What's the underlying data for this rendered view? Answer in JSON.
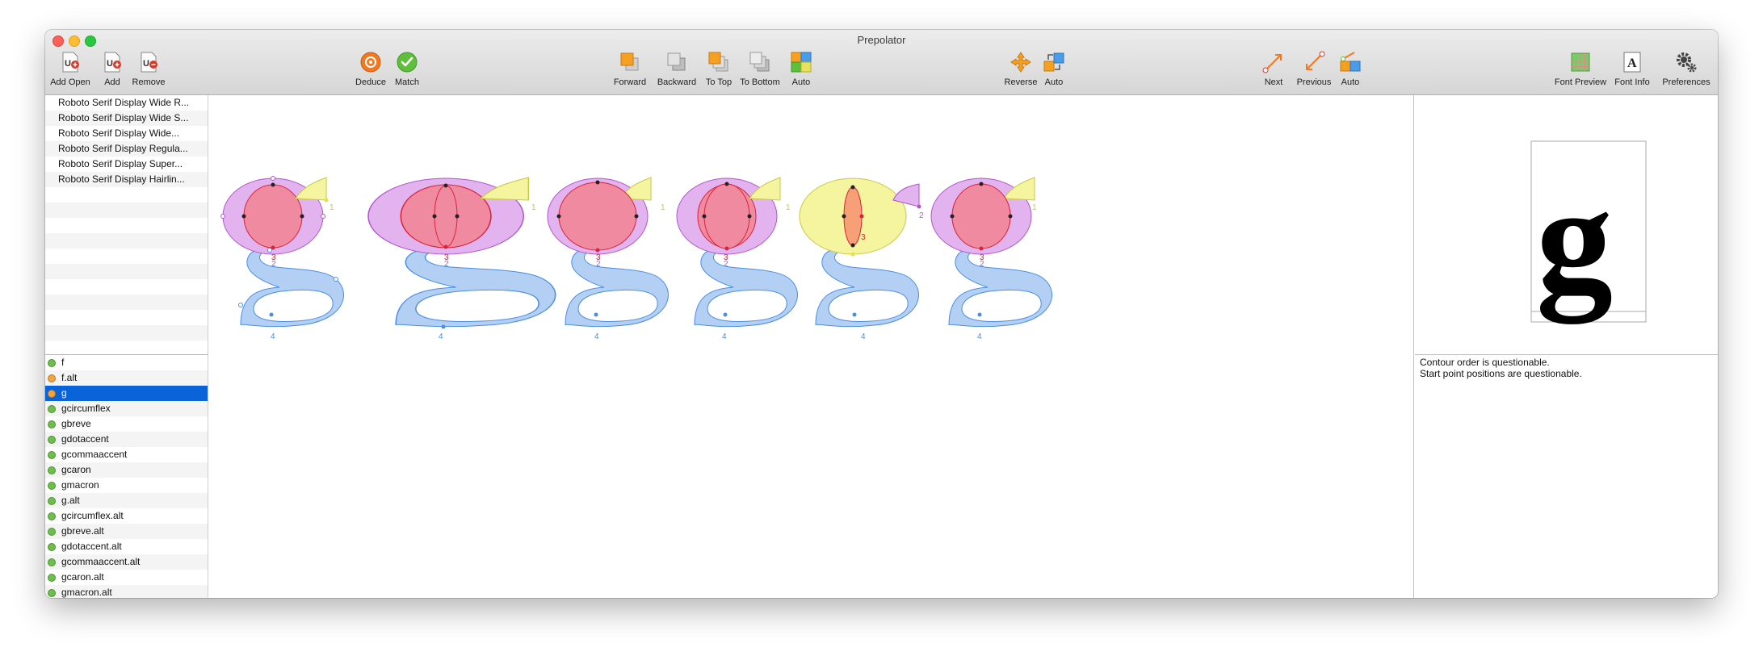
{
  "window": {
    "title": "Prepolator"
  },
  "toolbar": {
    "add_open": "Add Open",
    "add": "Add",
    "remove": "Remove",
    "deduce": "Deduce",
    "match": "Match",
    "forward": "Forward",
    "backward": "Backward",
    "to_top": "To Top",
    "to_bottom": "To Bottom",
    "auto_order": "Auto",
    "reverse": "Reverse",
    "auto_direction": "Auto",
    "next": "Next",
    "previous": "Previous",
    "auto_start": "Auto",
    "font_preview": "Font Preview",
    "font_info": "Font Info",
    "preferences": "Preferences"
  },
  "fonts": [
    "Roboto Serif Display Wide R...",
    "Roboto Serif Display Wide S...",
    "Roboto Serif Display Wide...",
    "Roboto Serif Display Regula...",
    "Roboto Serif Display Super...",
    "Roboto Serif Display Hairlin..."
  ],
  "glyphs": [
    {
      "name": "f",
      "status": "green"
    },
    {
      "name": "f.alt",
      "status": "orange"
    },
    {
      "name": "g",
      "status": "orange",
      "selected": true
    },
    {
      "name": "gcircumflex",
      "status": "green"
    },
    {
      "name": "gbreve",
      "status": "green"
    },
    {
      "name": "gdotaccent",
      "status": "green"
    },
    {
      "name": "gcommaaccent",
      "status": "green"
    },
    {
      "name": "gcaron",
      "status": "green"
    },
    {
      "name": "gmacron",
      "status": "green"
    },
    {
      "name": "g.alt",
      "status": "green"
    },
    {
      "name": "gcircumflex.alt",
      "status": "green"
    },
    {
      "name": "gbreve.alt",
      "status": "green"
    },
    {
      "name": "gdotaccent.alt",
      "status": "green"
    },
    {
      "name": "gcommaaccent.alt",
      "status": "green"
    },
    {
      "name": "gcaron.alt",
      "status": "green"
    },
    {
      "name": "gmacron.alt",
      "status": "green"
    }
  ],
  "status_colors": {
    "green": "#6cc04a",
    "orange": "#f3a43b"
  },
  "contour_colors": {
    "counter_red": "#f08aa0",
    "bowl_violet": "#e2b3ee",
    "ear_yellow": "#f4f59e",
    "tail_blue": "#b3cff4"
  },
  "canvas": {
    "contour_labels": {
      "one": "1",
      "two": "2",
      "three": "3",
      "four": "4"
    }
  },
  "preview": {
    "glyph_char": "g"
  },
  "report": {
    "messages": [
      "Contour order is questionable.",
      "Start point positions are questionable."
    ]
  }
}
